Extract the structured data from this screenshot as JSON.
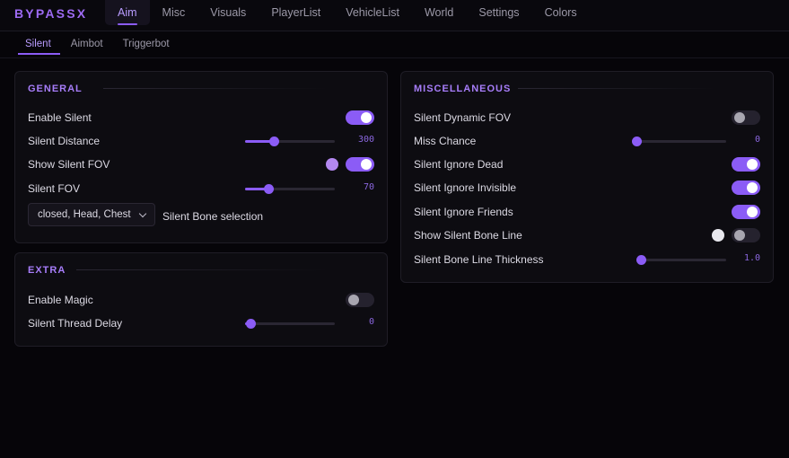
{
  "brand": "BYPASSX",
  "nav": [
    "Aim",
    "Misc",
    "Visuals",
    "PlayerList",
    "VehicleList",
    "World",
    "Settings",
    "Colors"
  ],
  "nav_active": "Aim",
  "subtabs": [
    "Silent",
    "Aimbot",
    "Triggerbot"
  ],
  "subtab_active": "Silent",
  "colors": {
    "accent": "#8b5cf6",
    "bg": "#060509",
    "panel": "#0d0c11",
    "fov_color": "#b388f0",
    "bone_line_color": "#e8e8ee"
  },
  "general": {
    "title": "GENERAL",
    "enable_silent": {
      "label": "Enable Silent",
      "on": true
    },
    "silent_distance": {
      "label": "Silent Distance",
      "value": "300",
      "fraction": 0.32
    },
    "show_silent_fov": {
      "label": "Show Silent FOV",
      "on": true
    },
    "silent_fov": {
      "label": "Silent FOV",
      "value": "70",
      "fraction": 0.26
    },
    "bone_selection": {
      "value": "closed, Head, Chest",
      "label": "Silent Bone selection"
    }
  },
  "extra": {
    "title": "EXTRA",
    "enable_magic": {
      "label": "Enable Magic",
      "on": false
    },
    "thread_delay": {
      "label": "Silent Thread Delay",
      "value": "0",
      "fraction": 0.06
    }
  },
  "misc": {
    "title": "MISCELLANEOUS",
    "dynamic_fov": {
      "label": "Silent Dynamic FOV",
      "on": false
    },
    "miss_chance": {
      "label": "Miss Chance",
      "value": "0",
      "fraction": 0.0
    },
    "ignore_dead": {
      "label": "Silent Ignore Dead",
      "on": true
    },
    "ignore_invisible": {
      "label": "Silent Ignore Invisible",
      "on": true
    },
    "ignore_friends": {
      "label": "Silent Ignore Friends",
      "on": true
    },
    "bone_line": {
      "label": "Show Silent Bone Line",
      "on": false
    },
    "bone_thickness": {
      "label": "Silent Bone Line Thickness",
      "value": "1.0",
      "fraction": 0.05
    }
  }
}
